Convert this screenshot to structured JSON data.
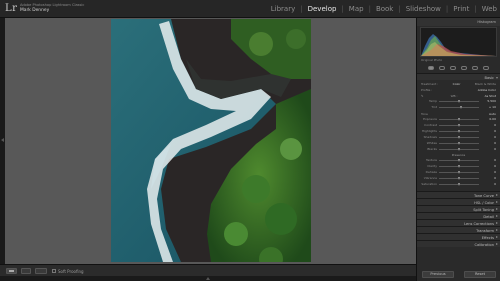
{
  "app": {
    "logo_text": "Lr",
    "catalog_line": "Adobe Photoshop Lightroom Classic",
    "user_name": "Mark Denney"
  },
  "modules": [
    {
      "label": "Library",
      "active": false
    },
    {
      "label": "Develop",
      "active": true
    },
    {
      "label": "Map",
      "active": false
    },
    {
      "label": "Book",
      "active": false
    },
    {
      "label": "Slideshow",
      "active": false
    },
    {
      "label": "Print",
      "active": false
    },
    {
      "label": "Web",
      "active": false
    }
  ],
  "right_panel": {
    "histogram_title": "Histogram",
    "histogram_info": "Original Photo",
    "basic_title": "Basic",
    "treatment_label": "Treatment :",
    "treatment_color": "Color",
    "treatment_bw": "Black & White",
    "profile_label": "Profile :",
    "profile_value": "Adobe Color",
    "wb_label": "WB :",
    "wb_value": "As Shot",
    "sliders_wb": [
      {
        "label": "Temp",
        "value": "5,500",
        "pos": 0.52
      },
      {
        "label": "Tint",
        "value": "+ 10",
        "pos": 0.55
      }
    ],
    "tone_label": "Tone",
    "tone_auto": "Auto",
    "sliders_tone": [
      {
        "label": "Exposure",
        "value": "0.00",
        "pos": 0.5
      },
      {
        "label": "Contrast",
        "value": "0",
        "pos": 0.5
      },
      {
        "label": "Highlights",
        "value": "0",
        "pos": 0.5
      },
      {
        "label": "Shadows",
        "value": "0",
        "pos": 0.5
      },
      {
        "label": "Whites",
        "value": "0",
        "pos": 0.5
      },
      {
        "label": "Blacks",
        "value": "0",
        "pos": 0.5
      }
    ],
    "presence_label": "Presence",
    "sliders_presence": [
      {
        "label": "Texture",
        "value": "0",
        "pos": 0.5
      },
      {
        "label": "Clarity",
        "value": "0",
        "pos": 0.5
      },
      {
        "label": "Dehaze",
        "value": "0",
        "pos": 0.5
      },
      {
        "label": "Vibrance",
        "value": "0",
        "pos": 0.5
      },
      {
        "label": "Saturation",
        "value": "0",
        "pos": 0.5
      }
    ],
    "collapsed_sections": [
      "Tone Curve",
      "HSL / Color",
      "Split Toning",
      "Detail",
      "Lens Corrections",
      "Transform",
      "Effects",
      "Calibration"
    ],
    "previous_button": "Previous",
    "reset_button": "Reset"
  },
  "toolbar": {
    "soft_proofing_label": "Soft Proofing"
  },
  "colors": {
    "panel_bg": "#2a2a2a",
    "canvas_bg": "#585858",
    "active_module": "#e6e6e6"
  }
}
